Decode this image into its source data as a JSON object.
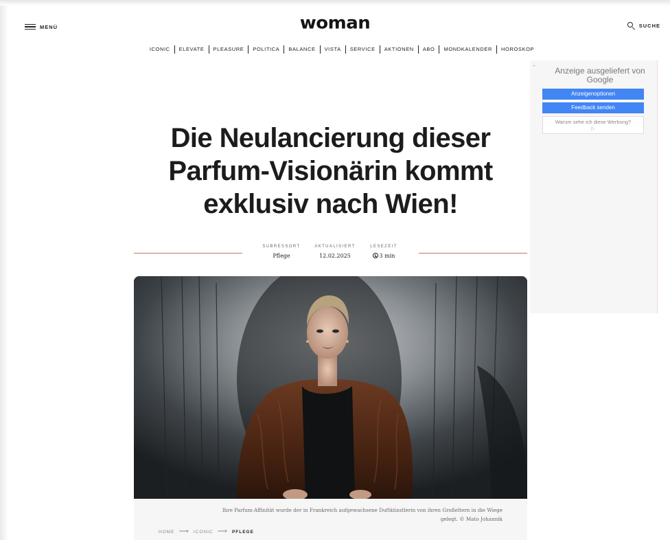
{
  "header": {
    "menu_label": "MENÜ",
    "logo": "woman",
    "search_label": "SUCHE"
  },
  "nav": {
    "items": [
      "ICONIC",
      "ELEVATE",
      "PLEASURE",
      "POLITICA",
      "BALANCE",
      "VISTA",
      "SERVICE",
      "AKTIONEN",
      "ABO",
      "MONDKALENDER",
      "HOROSKOP"
    ]
  },
  "article": {
    "headline_lines": [
      "Die Neulancierung dieser",
      "Parfum-Visionärin kommt",
      "exklusiv nach Wien!"
    ],
    "meta": {
      "subressort_label": "SUBRESSORT",
      "subressort_value": "Pflege",
      "updated_label": "AKTUALISIERT",
      "updated_value": "12.02.2025",
      "readtime_label": "LESEZEIT",
      "readtime_value": "3 min"
    },
    "image_caption_lines": [
      "Ihre Parfum-Affinität wurde der in Frankreich aufgewachsene Duftkünstlerin von ihren Großeltern in die Wiege",
      "gelegt. © Mato Johannik"
    ],
    "breadcrumb": [
      "HOME",
      "ICONIC",
      "PFLEGE"
    ]
  },
  "ad": {
    "title": "Anzeige ausgeliefert von",
    "brand": "Google",
    "options_button": "Anzeigenoptionen",
    "feedback_button": "Feedback senden",
    "why_link": "Warum sehe ich diese Werbung?"
  },
  "colors": {
    "accent_line": "#c8735f",
    "ad_button": "#4285f4"
  },
  "icons": [
    "hamburger-icon",
    "search-icon",
    "clock-icon",
    "arrow-right-icon",
    "back-arrow-icon",
    "play-icon"
  ]
}
